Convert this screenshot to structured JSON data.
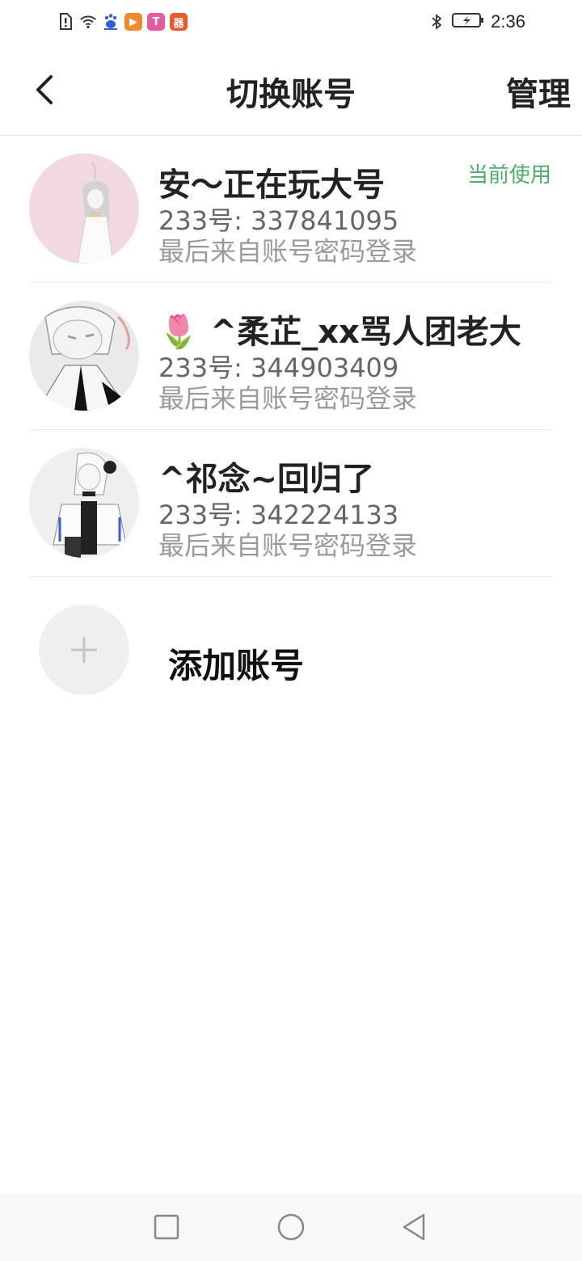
{
  "status_bar": {
    "time": "2:36",
    "left_icons": [
      "sim-alert-icon",
      "wifi-icon",
      "baidu-icon"
    ],
    "apps": [
      {
        "name": "video-app-icon",
        "glyph": "▶",
        "color": "#f08a2c"
      },
      {
        "name": "toolbox-app-icon",
        "glyph": "T",
        "color": "#e85aa0"
      },
      {
        "name": "grid-app-icon",
        "glyph": "器",
        "color": "#e85a2c"
      }
    ],
    "right_icons": [
      "bluetooth-icon",
      "battery-charging-icon"
    ]
  },
  "header": {
    "title": "切换账号",
    "manage_label": "管理"
  },
  "accounts": [
    {
      "name": "安～正在玩大号",
      "id": "233号: 337841095",
      "login": "最后来自账号密码登录",
      "badge": "当前使用",
      "current": true,
      "avatar_bg": "#f2d9df"
    },
    {
      "name": "🌷 ^柔芷_xx骂人团老大",
      "id": "233号: 344903409",
      "login": "最后来自账号密码登录",
      "badge": "",
      "current": false,
      "avatar_bg": "#ece9ea"
    },
    {
      "name": "^祁念~回归了",
      "id": "233号: 342224133",
      "login": "最后来自账号密码登录",
      "badge": "",
      "current": false,
      "avatar_bg": "#f1eeee"
    }
  ],
  "add_account": {
    "label": "添加账号"
  },
  "nav": {
    "buttons": [
      "recents-square-icon",
      "home-circle-icon",
      "back-triangle-icon"
    ]
  },
  "colors": {
    "accent_green": "#4caf6b",
    "text_primary": "#222222",
    "text_secondary": "#666666",
    "text_tertiary": "#9a9a9a"
  }
}
